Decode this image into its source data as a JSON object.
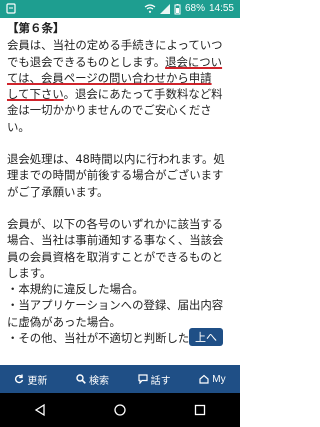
{
  "status_bar": {
    "battery_percent": "68%",
    "time": "14:55"
  },
  "article": {
    "heading": "【第６条】",
    "p1": {
      "l1": "会員は、当社の定める手続きによっていつ",
      "l2a": "でも退会できるものとします。",
      "l2b": "退会につい",
      "l3a": "ては、会員ページの問い合わせから申請",
      "l4a": "して下さい",
      "l4b": "。退会にあたって手数料など料",
      "l5": "金は一切かかりませんのでご安心くださ",
      "l6": "い。"
    },
    "p2": {
      "l1": "退会処理は、48時間以内に行われます。処",
      "l2": "理までの時間が前後する場合がございます",
      "l3": "がご了承願います。"
    },
    "p3": {
      "l1": "会員が、以下の各号のいずれかに該当する",
      "l2": "場合、当社は事前通知する事なく、当該会",
      "l3": "員の会員資格を取消すことができるものと",
      "l4": "します。",
      "b1": "・本規約に違反した場合。",
      "b2": "・当アプリケーションへの登録、届出内容",
      "b2b": "に虚偽があった場合。",
      "b3": "・その他、当社が不適切と判断した場合。"
    }
  },
  "back_to_top": "上へ",
  "bottom_nav": {
    "refresh": "更新",
    "search": "検索",
    "talk": "話す",
    "my": "My"
  },
  "icons": {
    "status_left": "sim-card-icon",
    "wifi": "wifi-icon",
    "signal": "signal-icon",
    "battery": "battery-icon"
  },
  "colors": {
    "status_bar": "#1e9e90",
    "bottom_bar": "#1f4f86",
    "underline": "#d0242c"
  }
}
